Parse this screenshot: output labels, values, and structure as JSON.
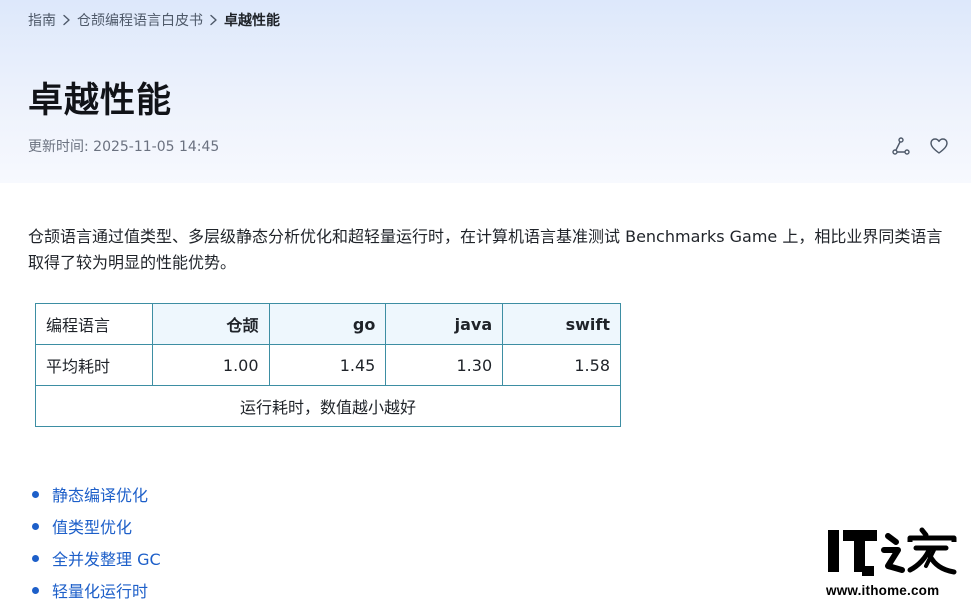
{
  "breadcrumb": {
    "items": [
      "指南",
      "仓颉编程语言白皮书",
      "卓越性能"
    ]
  },
  "page": {
    "title": "卓越性能",
    "updated": "更新时间: 2025-11-05 14:45"
  },
  "icons": {
    "share": "share-icon",
    "favorite": "heart-icon",
    "separator": "chevron-right-icon"
  },
  "content": {
    "intro": "仓颉语言通过值类型、多层级静态分析优化和超轻量运行时，在计算机语言基准测试 Benchmarks Game 上，相比业界同类语言取得了较为明显的性能优势。"
  },
  "table": {
    "headers": [
      "编程语言",
      "仓颉",
      "go",
      "java",
      "swift"
    ],
    "row": [
      "平均耗时",
      "1.00",
      "1.45",
      "1.30",
      "1.58"
    ],
    "note": "运行耗时，数值越小越好"
  },
  "links": [
    "静态编译优化",
    "值类型优化",
    "全并发整理 GC",
    "轻量化运行时"
  ],
  "watermark": {
    "logo_text": "IT之家",
    "url": "www.ithome.com"
  },
  "colors": {
    "link": "#1d5fc9",
    "table_border": "#3d8ea3",
    "table_header_bg": "#eef7fd",
    "hero_gradient_top": "#dde8fb"
  }
}
